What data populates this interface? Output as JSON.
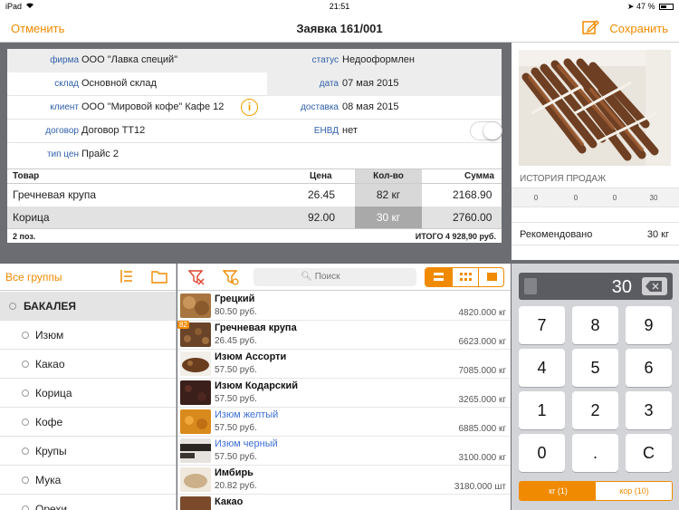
{
  "status_bar": {
    "device": "iPad",
    "time": "21:51",
    "battery": "47 %"
  },
  "nav": {
    "cancel": "Отменить",
    "title": "Заявка 161/001",
    "save": "Сохранить",
    "accent": "#f08a00"
  },
  "form": {
    "firm_label": "фирма",
    "firm": "ООО \"Лавка специй\"",
    "status_label": "статус",
    "status": "Недооформлен",
    "warehouse_label": "склад",
    "warehouse": "Основной склад",
    "date_label": "дата",
    "date": "07 мая 2015",
    "client_label": "клиент",
    "client": "ООО \"Мировой кофе\" Кафе 12",
    "delivery_label": "доставка",
    "delivery": "08 мая 2015",
    "contract_label": "договор",
    "contract": "Договор ТТ12",
    "envd_label": "ЕНВД",
    "envd": "нет",
    "envd_on": false,
    "price_type_label": "тип цен",
    "price_type": "Прайс 2"
  },
  "order": {
    "headers": {
      "product": "Товар",
      "price": "Цена",
      "qty": "Кол-во",
      "sum": "Сумма"
    },
    "rows": [
      {
        "product": "Гречневая крупа",
        "price": "26.45",
        "qty": "82 кг",
        "sum": "2168.90"
      },
      {
        "product": "Корица",
        "price": "92.00",
        "qty": "30 кг",
        "sum": "2760.00"
      }
    ],
    "count": "2 поз.",
    "total": "ИТОГО 4 928,90 руб."
  },
  "history": {
    "title": "ИСТОРИЯ ПРОДАЖ",
    "values": [
      "0",
      "0",
      "0",
      "30"
    ],
    "recommended_label": "Рекомендовано",
    "recommended_value": "30 кг"
  },
  "groups": {
    "all": "Все группы",
    "items": [
      "БАКАЛЕЯ",
      "Изюм",
      "Какао",
      "Корица",
      "Кофе",
      "Крупы",
      "Мука",
      "Орехи"
    ]
  },
  "products": {
    "search_placeholder": "Поиск",
    "items": [
      {
        "name": "Грецкий",
        "price": "80.50 руб.",
        "stock": "4820.000 кг"
      },
      {
        "name": "Гречневая крупа",
        "price": "26.45 руб.",
        "stock": "6623.000 кг",
        "badge": "82"
      },
      {
        "name": "Изюм Ассорти",
        "price": "57.50 руб.",
        "stock": "7085.000 кг"
      },
      {
        "name": "Изюм Кодарский",
        "price": "57.50 руб.",
        "stock": "3265.000 кг"
      },
      {
        "name": "Изюм желтый",
        "price": "57.50 руб.",
        "stock": "6885.000 кг"
      },
      {
        "name": "Изюм черный",
        "price": "57.50 руб.",
        "stock": "3100.000 кг"
      },
      {
        "name": "Имбирь",
        "price": "20.82 руб.",
        "stock": "3180.000 шт"
      },
      {
        "name": "Какао",
        "price": "",
        "stock": ""
      }
    ]
  },
  "keypad": {
    "value": "30",
    "keys": [
      "7",
      "8",
      "9",
      "4",
      "5",
      "6",
      "1",
      "2",
      "3",
      "0",
      ".",
      "C"
    ],
    "unit_on": "кг (1)",
    "unit_off": "кор (10)"
  }
}
